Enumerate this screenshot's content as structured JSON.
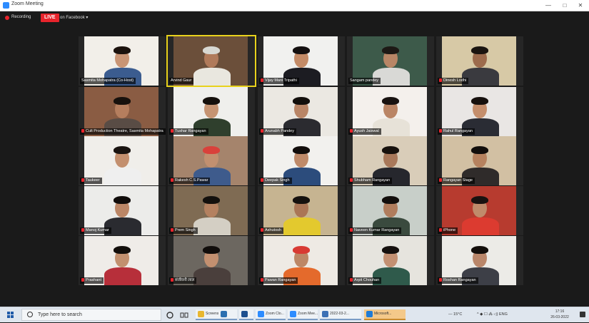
{
  "window": {
    "title": "Zoom Meeting",
    "minimize": "—",
    "maximize": "□",
    "close": "✕"
  },
  "topbar": {
    "recording_label": "Recording",
    "live_badge": "LIVE",
    "live_destination": "on Facebook ▾"
  },
  "participants": [
    {
      "name": "Sasmita Mohapatra (Co-Host)",
      "muted": false,
      "active_speaker": false,
      "bg": "#f2efe9",
      "shirt": "#3b5c8f",
      "skin": "#c99575",
      "hair": "#1b120d"
    },
    {
      "name": "Arvind Gaur",
      "muted": false,
      "active_speaker": true,
      "bg": "#6b4f3a",
      "shirt": "#e9e7df",
      "skin": "#b07a5a",
      "hair": "#d8d8d2"
    },
    {
      "name": "Vijay Mani Tripathi",
      "muted": true,
      "active_speaker": false,
      "bg": "#f1f1ef",
      "shirt": "#1c1c22",
      "skin": "#c48b67",
      "hair": "#141010"
    },
    {
      "name": "Sangam pandey",
      "muted": false,
      "active_speaker": false,
      "bg": "#3d5a4a",
      "shirt": "#d9d9d6",
      "skin": "#b88666",
      "hair": "#1d1915"
    },
    {
      "name": "Dinesh Lodhi",
      "muted": true,
      "active_speaker": false,
      "bg": "#d7c9a6",
      "shirt": "#3a3a3f",
      "skin": "#9c6b4d",
      "hair": "#1a1410"
    },
    {
      "name": "Cult Production Theatre, Sasmita Mohapatra",
      "muted": true,
      "active_speaker": false,
      "bg": "#8a5c43",
      "shirt": "#594c45",
      "skin": "#b57e5e",
      "hair": "#17110d"
    },
    {
      "name": "Tushar Rangayan",
      "muted": true,
      "active_speaker": false,
      "bg": "#efefec",
      "shirt": "#2f3f2d",
      "skin": "#c69472",
      "hair": "#15100c"
    },
    {
      "name": "Arunabh Pandey",
      "muted": true,
      "active_speaker": false,
      "bg": "#ebe8e2",
      "shirt": "#2b2b30",
      "skin": "#b98566",
      "hair": "#120e0b"
    },
    {
      "name": "Ayush Jaiswal",
      "muted": true,
      "active_speaker": false,
      "bg": "#f4f0ec",
      "shirt": "#e7e2d8",
      "skin": "#ba8565",
      "hair": "#181210"
    },
    {
      "name": "Rahul Rangayan",
      "muted": true,
      "active_speaker": false,
      "bg": "#e9e6e4",
      "shirt": "#2a2c34",
      "skin": "#c48e6c",
      "hair": "#16100d"
    },
    {
      "name": "Taukeer",
      "muted": true,
      "active_speaker": false,
      "bg": "#f0eeea",
      "shirt": "#efefef",
      "skin": "#c38f6e",
      "hair": "#191310"
    },
    {
      "name": "Rakesh C.S.Pawar",
      "muted": true,
      "active_speaker": false,
      "bg": "#a5846c",
      "shirt": "#3e5b8c",
      "skin": "#c29070",
      "hair": "#d9413b"
    },
    {
      "name": "Deepak Singh",
      "muted": true,
      "active_speaker": false,
      "bg": "#f2f1ee",
      "shirt": "#2c4c7c",
      "skin": "#bf8a69",
      "hair": "#120d0b"
    },
    {
      "name": "Shubham Rangayan",
      "muted": true,
      "active_speaker": false,
      "bg": "#d9cdb9",
      "shirt": "#26272d",
      "skin": "#a8785a",
      "hair": "#17110d"
    },
    {
      "name": "Rangayan Stage",
      "muted": true,
      "active_speaker": false,
      "bg": "#d2c0a3",
      "shirt": "#2f2b2a",
      "skin": "#b6825f",
      "hair": "#120e0c"
    },
    {
      "name": "Manoj Kumar",
      "muted": true,
      "active_speaker": false,
      "bg": "#ececea",
      "shirt": "#2a2b30",
      "skin": "#bb8666",
      "hair": "#100c0a"
    },
    {
      "name": "Prem Singh",
      "muted": true,
      "active_speaker": false,
      "bg": "#7f6b53",
      "shirt": "#d4cfc4",
      "skin": "#b48160",
      "hair": "#13100d"
    },
    {
      "name": "Ashutosh",
      "muted": true,
      "active_speaker": false,
      "bg": "#c6b491",
      "shirt": "#e3c92e",
      "skin": "#aa7656",
      "hair": "#15110e"
    },
    {
      "name": "Naveen Kumar Rangayan",
      "muted": true,
      "active_speaker": false,
      "bg": "#c8cfc9",
      "shirt": "#3a4a3e",
      "skin": "#b07d5d",
      "hair": "#120e0c"
    },
    {
      "name": "iPhone",
      "muted": true,
      "active_speaker": false,
      "bg": "#b73b2f",
      "shirt": "#dc3b30",
      "skin": "#c08b6b",
      "hair": "#1a1210"
    },
    {
      "name": "Prashant",
      "muted": true,
      "active_speaker": false,
      "bg": "#efece8",
      "shirt": "#b72f3a",
      "skin": "#c2906f",
      "hair": "#120e0b"
    },
    {
      "name": "संजीवनी लाल",
      "muted": true,
      "active_speaker": false,
      "bg": "#6c6760",
      "shirt": "#4a3f3c",
      "skin": "#c39070",
      "hair": "#110d0b"
    },
    {
      "name": "Pawan Rangayan",
      "muted": true,
      "active_speaker": false,
      "bg": "#eeeae4",
      "shirt": "#e46a2c",
      "skin": "#bd8766",
      "hair": "#d83a33"
    },
    {
      "name": "Arpit Chouhan",
      "muted": true,
      "active_speaker": false,
      "bg": "#e6e4de",
      "shirt": "#2f5a4b",
      "skin": "#c39072",
      "hair": "#15100e"
    },
    {
      "name": "Roshan Rangayan",
      "muted": true,
      "active_speaker": false,
      "bg": "#ecebe7",
      "shirt": "#3d3f47",
      "skin": "#b9866a",
      "hair": "#120e0b"
    }
  ],
  "taskbar": {
    "search_placeholder": "Type here to search",
    "apps": [
      {
        "label": "Screenshots",
        "icon": "folder-icon",
        "color": "#e8b730",
        "active": false
      },
      {
        "label": "",
        "icon": "lightroom-icon",
        "color": "#2b6fb0",
        "active": false
      },
      {
        "label": "",
        "icon": "photos-icon",
        "color": "#1d4f8f",
        "active": false
      },
      {
        "label": "Zoom Clo...",
        "icon": "zoom-icon",
        "color": "#2d8cff",
        "active": false
      },
      {
        "label": "Zoom Mee...",
        "icon": "zoom-icon",
        "color": "#2d8cff",
        "active": false
      },
      {
        "label": "2022-03-2...",
        "icon": "photo-viewer-icon",
        "color": "#3b70b5",
        "active": false
      },
      {
        "label": "Microsoft...",
        "icon": "edge-icon",
        "color": "#1f7bd6",
        "active": true
      }
    ],
    "weather": "— 15°C",
    "tray": "^ ◆ ☐ ⁂ ◁) ENG",
    "time": "17:16",
    "date": "26-03-2022"
  }
}
